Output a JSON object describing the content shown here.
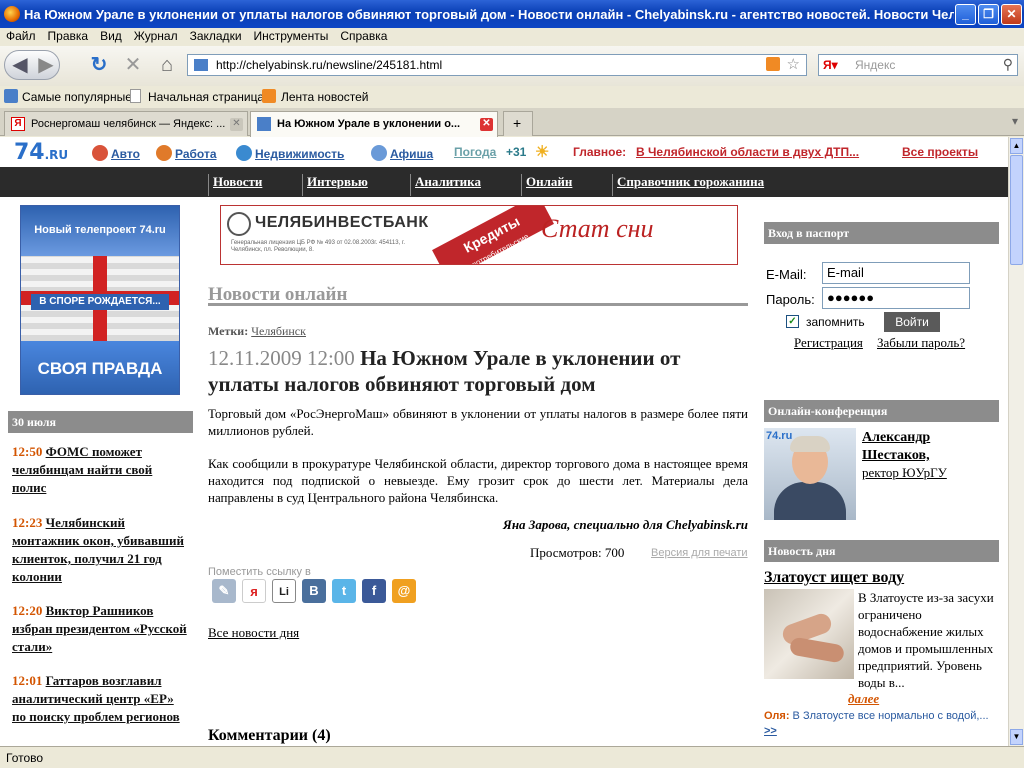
{
  "window": {
    "title": "На Южном Урале в уклонении от уплаты налогов обвиняют торговый дом - Новости онлайн - Chelyabinsk.ru - агентство новостей. Новости Челя..."
  },
  "menu": [
    "Файл",
    "Правка",
    "Вид",
    "Журнал",
    "Закладки",
    "Инструменты",
    "Справка"
  ],
  "navigation": {
    "url": "http://chelyabinsk.ru/newsline/245181.html",
    "search_placeholder": "Яндекс"
  },
  "bookmarks": [
    "Самые популярные",
    "Начальная страница",
    "Лента новостей"
  ],
  "tabs": [
    {
      "label": "Роснергомаш челябинск — Яндекс: ..."
    },
    {
      "label": "На Южном Урале в уклонении о..."
    }
  ],
  "site": {
    "logo": "74",
    "logo_suffix": ".RU",
    "top_links": [
      "Авто",
      "Работа",
      "Недвижимость",
      "Афиша"
    ],
    "weather_label": "Погода",
    "weather_value": "+31",
    "main_label": "Главное:",
    "main_text": "В Челябинской области в двух ДТП...",
    "all_projects": "Все проекты",
    "nav": [
      "Новости",
      "Интервью",
      "Аналитика",
      "Онлайн",
      "Справочник горожанина"
    ]
  },
  "promo": {
    "top_text": "Новый телепроект 74.ru",
    "middle_text": "В СПОРЕ РОЖДАЕТСЯ...",
    "bottom_text": "СВОЯ ПРАВДА"
  },
  "left_news": {
    "date": "30 июля",
    "items": [
      {
        "time": "12:50",
        "title": "ФОМС поможет челябинцам найти свой полис"
      },
      {
        "time": "12:23",
        "title": "Челябинский монтажник окон, убивавший клиенток, получил 21 год колонии"
      },
      {
        "time": "12:20",
        "title": "Виктор Рашников избран президентом «Русской стали»"
      },
      {
        "time": "12:01",
        "title": "Гаттаров возглавил аналитический центр «ЕР» по поиску проблем регионов"
      }
    ]
  },
  "banner": {
    "bank_name": "ЧЕЛЯБИНВЕСТБАНК",
    "small_text": "Генеральная лицензия ЦБ РФ № 493 от 02.08.2003г. 454113, г. Челябинск, пл. Революции, 8.",
    "credit_text": "Кредиты",
    "credit_sub": "потребительские",
    "tagline": "Стат сни"
  },
  "article": {
    "section": "Новости онлайн",
    "tags_label": "Метки:",
    "tag": "Челябинск",
    "timestamp": "12.11.2009 12:00",
    "headline": "На Южном Урале в уклонении от уплаты налогов обвиняют торговый дом",
    "para1": "Торговый дом «РосЭнергоМаш» обвиняют в уклонении от уплаты налогов в размере более пяти миллионов рублей.",
    "para2": "Как сообщили в прокуратуре Челябинской области, директор торгового дома в настоящее время находится под подпиской о невыезде. Ему грозит срок до шести лет. Материалы дела направлены в суд Центрального района Челябинска.",
    "author": "Яна Зарова,",
    "author_role": "специально для Chelyabinsk.ru",
    "views": "Просмотров: 700",
    "print": "Версия для печати",
    "share_label": "Поместить ссылку в",
    "share_icons": [
      "lj-icon",
      "moikrug-icon",
      "liveinternet-icon",
      "vkontakte-icon",
      "twitter-icon",
      "facebook-icon",
      "mailru-icon"
    ],
    "share_glyphs": [
      "✎",
      "я",
      "Li",
      "B",
      "t",
      "f",
      "@"
    ],
    "all_news": "Все новости дня",
    "comments": "Комментарии (4)"
  },
  "login": {
    "header": "Вход в паспорт",
    "email_label": "E-Mail:",
    "email_value": "E-mail",
    "password_label": "Пароль:",
    "password_value": "●●●●●●",
    "remember": "запомнить",
    "submit": "Войти",
    "register": "Регистрация",
    "forgot": "Забыли пароль?"
  },
  "conference": {
    "header": "Онлайн-конференция",
    "name": "Александр Шестаков,",
    "role": "ректор ЮУрГУ",
    "img_logo": "74.ru"
  },
  "day_news": {
    "header": "Новость дня",
    "title": "Златоуст ищет воду",
    "text": "В Златоусте из-за засухи ограничено водоснабжение жилых домов и промышленных предприятий. Уровень воды в...",
    "more": "далее",
    "comment_author": "Оля:",
    "comment_text": "В Златоусте все нормально с водой,...",
    "comment_more": ">>"
  },
  "status_text": "Готово",
  "colors": {
    "accent_orange": "#d35400",
    "link_blue": "#2a5aa0",
    "nav_dark": "#2b2b2b",
    "header_gray": "#8c8c8c",
    "xp_blue": "#0a3fb5"
  }
}
